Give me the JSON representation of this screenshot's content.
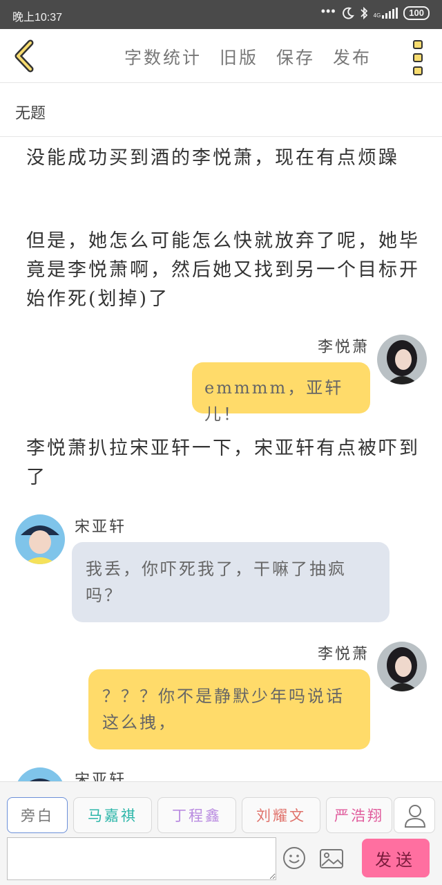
{
  "status_bar": {
    "time": "晚上10:37",
    "network_label": "4G",
    "battery": "100"
  },
  "header": {
    "actions": [
      "字数统计",
      "旧版",
      "保存",
      "发布"
    ]
  },
  "doc": {
    "title": "无题"
  },
  "messages": {
    "narration_1": "没能成功买到酒的李悦萧，现在有点烦躁",
    "narration_2": "但是，她怎么可能怎么快就放弃了呢，她毕竟是李悦萧啊，然后她又找到另一个目标开始作死(划掉)了",
    "speaker_1": "李悦萧",
    "bubble_1": "emmmm，亚轩儿！",
    "narration_3": "李悦萧扒拉宋亚轩一下，宋亚轩有点被吓到了",
    "speaker_2": "宋亚轩",
    "bubble_2": "我丢，你吓死我了，干嘛了抽疯吗？",
    "speaker_3": "李悦萧",
    "bubble_3": "？？？你不是静默少年吗说话这么拽，",
    "speaker_4": "宋亚轩"
  },
  "roles": [
    {
      "label": "旁白",
      "color": "#777777"
    },
    {
      "label": "马嘉祺",
      "color": "#2bb5a8"
    },
    {
      "label": "丁程鑫",
      "color": "#b98be0"
    },
    {
      "label": "刘耀文",
      "color": "#e0726b"
    },
    {
      "label": "严浩翔",
      "color": "#e05b9c"
    }
  ],
  "composer": {
    "input_value": "",
    "send_label": "发送"
  },
  "colors": {
    "accent_yellow": "#ffdb6a",
    "bubble_gray": "#e0e5ee",
    "send_pink": "#ff6fa0"
  }
}
